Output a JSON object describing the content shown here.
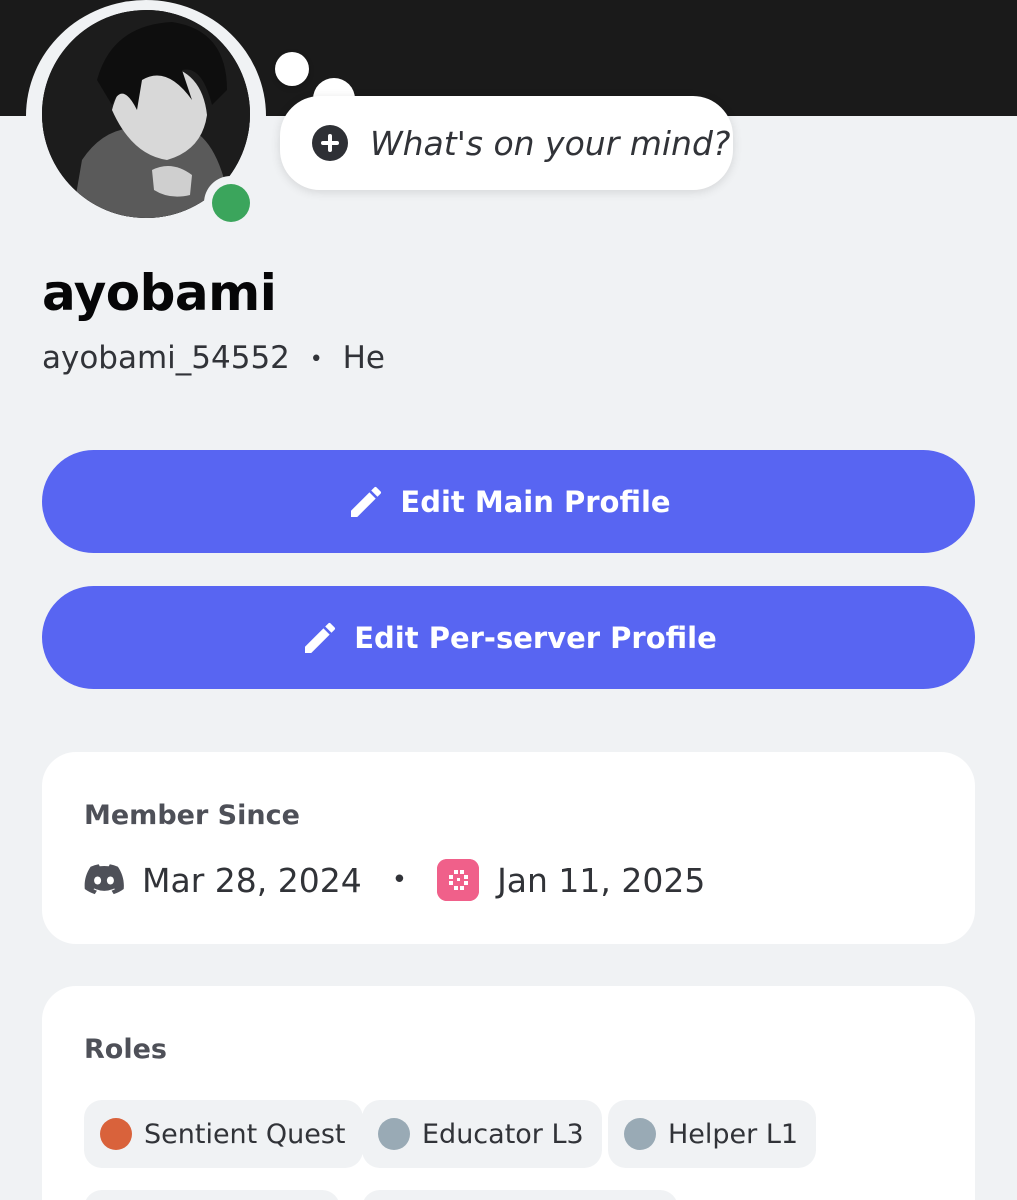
{
  "profile": {
    "display_name": "ayobami",
    "username": "ayobami_54552",
    "pronouns": "He",
    "separator": "•",
    "status_placeholder": "What's on your mind?",
    "online_color": "#3ba55c"
  },
  "buttons": {
    "edit_main": "Edit Main Profile",
    "edit_server": "Edit Per-server Profile",
    "accent": "#5865f2"
  },
  "member_since": {
    "title": "Member Since",
    "discord_date": "Mar 28, 2024",
    "separator": "•",
    "server_date": "Jan 11, 2025"
  },
  "roles": {
    "title": "Roles",
    "items": [
      {
        "label": "Sentient Quest",
        "color": "#d9623b"
      },
      {
        "label": "Educator L3",
        "color": "#99aab5"
      },
      {
        "label": "Helper L1",
        "color": "#99aab5"
      }
    ]
  },
  "icons": {
    "edit": "pencil-icon",
    "discord": "discord-icon",
    "server": "server-icon",
    "add_status": "plus-circle-icon"
  }
}
